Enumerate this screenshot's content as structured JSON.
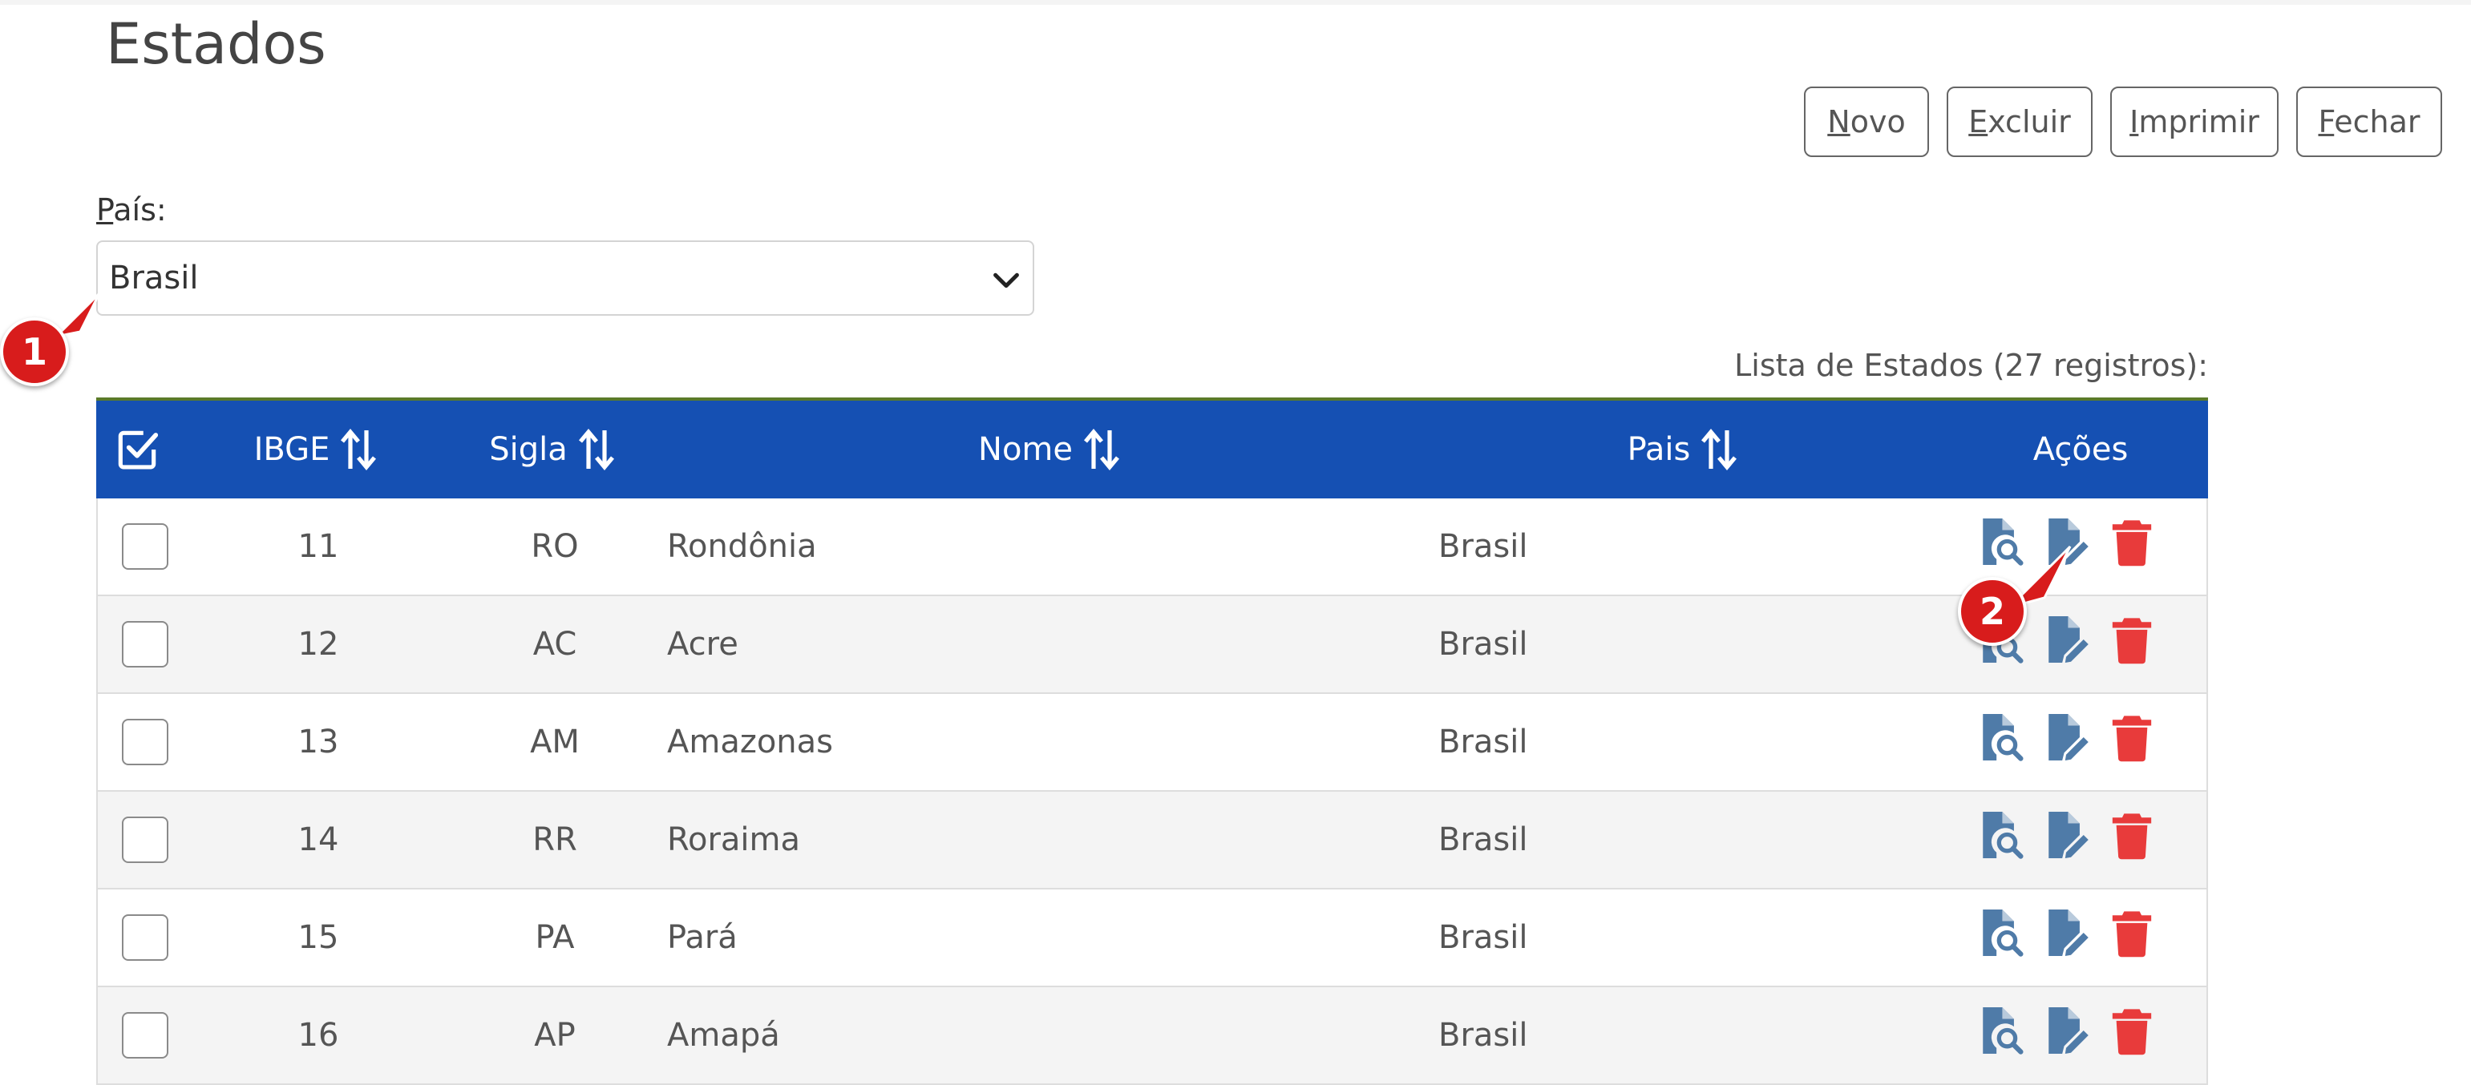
{
  "page": {
    "title": "Estados"
  },
  "toolbar": {
    "novo": "Novo",
    "excluir": "Excluir",
    "imprimir": "Imprimir",
    "fechar": "Fechar"
  },
  "filter": {
    "country_label": "País:",
    "country_value": "Brasil"
  },
  "list": {
    "caption": "Lista de Estados (27 registros):",
    "columns": {
      "ibge": "IBGE",
      "sigla": "Sigla",
      "nome": "Nome",
      "pais": "Pais",
      "acoes": "Ações"
    },
    "rows": [
      {
        "ibge": "11",
        "sigla": "RO",
        "nome": "Rondônia",
        "pais": "Brasil"
      },
      {
        "ibge": "12",
        "sigla": "AC",
        "nome": "Acre",
        "pais": "Brasil"
      },
      {
        "ibge": "13",
        "sigla": "AM",
        "nome": "Amazonas",
        "pais": "Brasil"
      },
      {
        "ibge": "14",
        "sigla": "RR",
        "nome": "Roraima",
        "pais": "Brasil"
      },
      {
        "ibge": "15",
        "sigla": "PA",
        "nome": "Pará",
        "pais": "Brasil"
      },
      {
        "ibge": "16",
        "sigla": "AP",
        "nome": "Amapá",
        "pais": "Brasil"
      }
    ]
  },
  "annotations": {
    "badge1": "1",
    "badge2": "2"
  },
  "colors": {
    "header_bg": "#1550b3",
    "action_icon": "#4f7ba8",
    "delete_icon": "#e83b3b",
    "badge": "#d81c1c"
  },
  "icons": {
    "view": "file-search-icon",
    "edit": "file-edit-icon",
    "delete": "trash-icon",
    "sort": "sort-arrows-icon",
    "select_all": "check-square-icon"
  }
}
